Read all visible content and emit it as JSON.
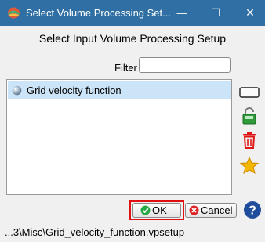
{
  "window": {
    "title": "Select Volume Processing Set...",
    "minimize_glyph": "—",
    "maximize_glyph": "☐",
    "close_glyph": "✕",
    "title_bar_color": "#2f6fa3"
  },
  "dialog": {
    "heading": "Select Input Volume Processing Setup",
    "filter_label": "Filter",
    "filter_value": ""
  },
  "list": {
    "items": [
      {
        "label": "Grid velocity function",
        "icon": "sphere-icon",
        "selected": true
      }
    ],
    "selection_color": "#cce4f7"
  },
  "side_toolbar": {
    "icons": [
      "rectangle-icon",
      "save-lock-icon",
      "trash-icon",
      "star-icon"
    ]
  },
  "buttons": {
    "ok_label": "OK",
    "cancel_label": "Cancel",
    "ok_highlight_color": "#e01010"
  },
  "status": {
    "path": "...3\\Misc\\Grid_velocity_function.vpsetup"
  }
}
